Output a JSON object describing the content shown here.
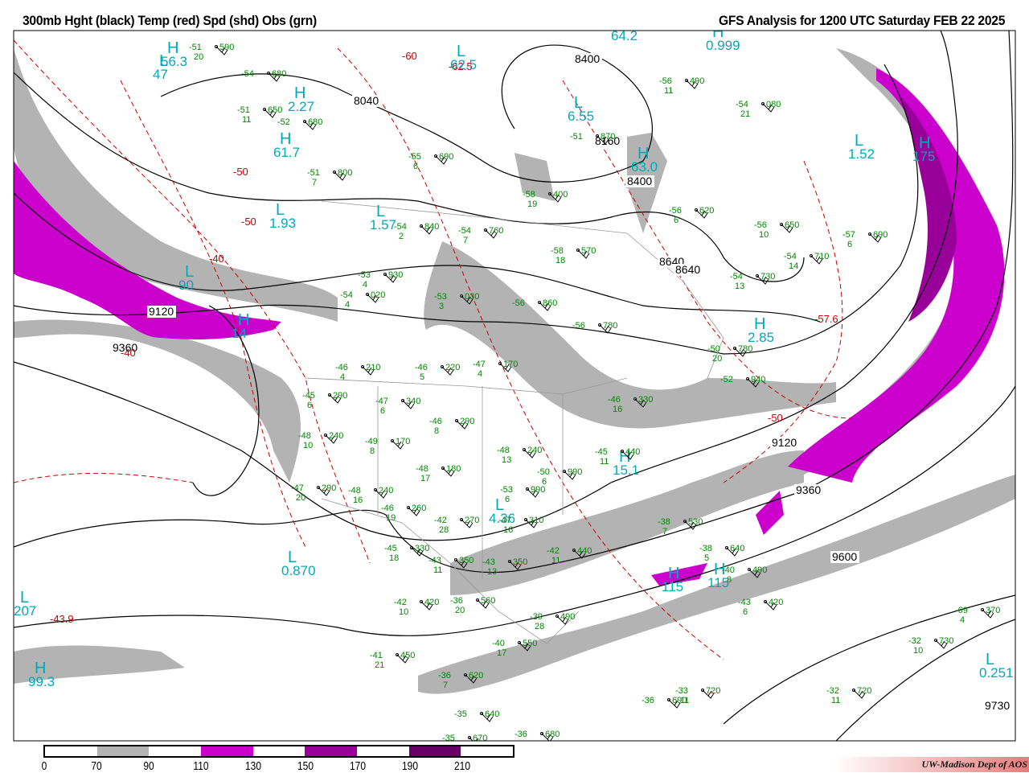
{
  "header": {
    "title_left": "300mb Hght (black) Temp (red) Spd (shd) Obs (grn)",
    "title_right": "GFS Analysis for 1200 UTC Saturday  FEB 22 2025"
  },
  "legend": {
    "labels": [
      "0",
      "70",
      "90",
      "110",
      "130",
      "150",
      "170",
      "190",
      "210"
    ],
    "colors": [
      "#ffffff",
      "#b3b3b3",
      "#ffffff",
      "#cc00cc",
      "#ffffff",
      "#990099",
      "#ffffff",
      "#660066",
      "#ffffff"
    ]
  },
  "credit": "UW-Madison  Dept of AOS",
  "colors": {
    "height": "#000000",
    "temp": "#cc0000",
    "obs": "#008800",
    "centers": "#00aabb",
    "speed_gray": "#b3b3b3",
    "speed_magenta": "#cc00cc"
  },
  "height_labels": [
    "8040",
    "8160",
    "8400",
    "8640",
    "8640",
    "9120",
    "9120",
    "9360",
    "9360",
    "9600",
    "9730",
    "8400"
  ],
  "temp_labels": [
    "-50",
    "-50",
    "-40",
    "-60",
    "-50",
    "-40",
    "-43.9",
    "-62.5",
    "-57.6"
  ],
  "centers": [
    {
      "letter": "H",
      "value": "56.3"
    },
    {
      "letter": "L",
      "value": "47"
    },
    {
      "letter": "H",
      "value": "2.27"
    },
    {
      "letter": "H",
      "value": "61.7"
    },
    {
      "letter": "L",
      "value": "1.93"
    },
    {
      "letter": "L",
      "value": "1.57"
    },
    {
      "letter": "L",
      "value": "62.5"
    },
    {
      "letter": "H",
      "value": "64.2"
    },
    {
      "letter": "L",
      "value": "6.55"
    },
    {
      "letter": "H",
      "value": "63.0"
    },
    {
      "letter": "H",
      "value": "0.999"
    },
    {
      "letter": "L",
      "value": "1.52"
    },
    {
      "letter": "H",
      "value": "115"
    },
    {
      "letter": "L",
      "value": "90"
    },
    {
      "letter": "H",
      "value": "14"
    },
    {
      "letter": "L",
      "value": "0.870"
    },
    {
      "letter": "L",
      "value": "207"
    },
    {
      "letter": "H",
      "value": "99.3"
    },
    {
      "letter": "L",
      "value": "4.36"
    },
    {
      "letter": "H",
      "value": "15.1"
    },
    {
      "letter": "L",
      "value": "0.251"
    },
    {
      "letter": "H",
      "value": "115"
    },
    {
      "letter": "H",
      "value": "2.85"
    },
    {
      "letter": "H",
      "value": "175"
    }
  ],
  "obs": [
    {
      "t": "-51",
      "h": "590",
      "w": "20"
    },
    {
      "t": "-54",
      "h": "680",
      "w": ""
    },
    {
      "t": "-51",
      "h": "650",
      "w": "11"
    },
    {
      "t": "-52",
      "h": "680",
      "w": ""
    },
    {
      "t": "-51",
      "h": "800",
      "w": "7"
    },
    {
      "t": "-55",
      "h": "690",
      "w": "6"
    },
    {
      "t": "-54",
      "h": "840",
      "w": "2"
    },
    {
      "t": "-54",
      "h": "760",
      "w": "7"
    },
    {
      "t": "-58",
      "h": "400",
      "w": "19"
    },
    {
      "t": "-58",
      "h": "570",
      "w": "18"
    },
    {
      "t": "-56",
      "h": "620",
      "w": "6"
    },
    {
      "t": "-56",
      "h": "650",
      "w": "10"
    },
    {
      "t": "-57",
      "h": "690",
      "w": "6"
    },
    {
      "t": "-54",
      "h": "710",
      "w": "14"
    },
    {
      "t": "-54",
      "h": "730",
      "w": "13"
    },
    {
      "t": "-53",
      "h": "930",
      "w": "4"
    },
    {
      "t": "-53",
      "h": "030",
      "w": "3"
    },
    {
      "t": "-54",
      "h": "020",
      "w": "4"
    },
    {
      "t": "-56",
      "h": "860",
      "w": ""
    },
    {
      "t": "-56",
      "h": "780",
      "w": ""
    },
    {
      "t": "-50",
      "h": "780",
      "w": "20"
    },
    {
      "t": "-46",
      "h": "220",
      "w": "5"
    },
    {
      "t": "-47",
      "h": "170",
      "w": "4"
    },
    {
      "t": "-46",
      "h": "210",
      "w": "4"
    },
    {
      "t": "-45",
      "h": "290",
      "w": "6"
    },
    {
      "t": "-47",
      "h": "340",
      "w": "6"
    },
    {
      "t": "-46",
      "h": "290",
      "w": "8"
    },
    {
      "t": "-48",
      "h": "240",
      "w": "10"
    },
    {
      "t": "-49",
      "h": "170",
      "w": "8"
    },
    {
      "t": "-48",
      "h": "180",
      "w": "17"
    },
    {
      "t": "-48",
      "h": "240",
      "w": "13"
    },
    {
      "t": "-50",
      "h": "990",
      "w": "6"
    },
    {
      "t": "-53",
      "h": "990",
      "w": "6"
    },
    {
      "t": "-45",
      "h": "440",
      "w": "11"
    },
    {
      "t": "-46",
      "h": "330",
      "w": "16"
    },
    {
      "t": "-47",
      "h": "290",
      "w": "20"
    },
    {
      "t": "-48",
      "h": "240",
      "w": "16"
    },
    {
      "t": "-46",
      "h": "260",
      "w": "19"
    },
    {
      "t": "-42",
      "h": "270",
      "w": "28"
    },
    {
      "t": "-47",
      "h": "310",
      "w": "16"
    },
    {
      "t": "-45",
      "h": "330",
      "w": "18"
    },
    {
      "t": "-43",
      "h": "350",
      "w": "11"
    },
    {
      "t": "-43",
      "h": "350",
      "w": "13"
    },
    {
      "t": "-42",
      "h": "440",
      "w": "11"
    },
    {
      "t": "-38",
      "h": "530",
      "w": "7"
    },
    {
      "t": "-38",
      "h": "640",
      "w": "5"
    },
    {
      "t": "-40",
      "h": "490",
      "w": "8"
    },
    {
      "t": "-43",
      "h": "420",
      "w": "6"
    },
    {
      "t": "-39",
      "h": "490",
      "w": "28"
    },
    {
      "t": "-40",
      "h": "550",
      "w": "17"
    },
    {
      "t": "-41",
      "h": "450",
      "w": "21"
    },
    {
      "t": "-42",
      "h": "420",
      "w": "10"
    },
    {
      "t": "-36",
      "h": "560",
      "w": "20"
    },
    {
      "t": "-36",
      "h": "620",
      "w": "7"
    },
    {
      "t": "-35",
      "h": "640",
      "w": ""
    },
    {
      "t": "-35",
      "h": "670",
      "w": ""
    },
    {
      "t": "-36",
      "h": "680",
      "w": ""
    },
    {
      "t": "-36",
      "h": "690",
      "w": ""
    },
    {
      "t": "-33",
      "h": "720",
      "w": "11"
    },
    {
      "t": "-32",
      "h": "720",
      "w": "11"
    },
    {
      "t": "-32",
      "h": "730",
      "w": "10"
    },
    {
      "t": "-69",
      "h": "370",
      "w": "4"
    },
    {
      "t": "-56",
      "h": "490",
      "w": "11"
    },
    {
      "t": "-54",
      "h": "080",
      "w": "21"
    },
    {
      "t": "-51",
      "h": "870",
      "w": ""
    },
    {
      "t": "-52",
      "h": "940",
      "w": ""
    }
  ]
}
